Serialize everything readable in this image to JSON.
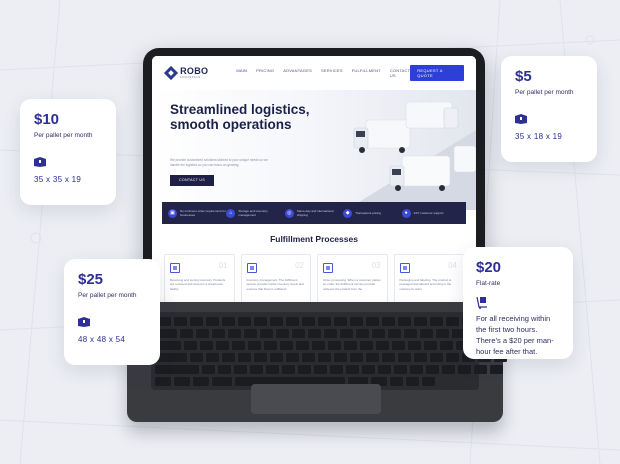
{
  "site": {
    "logo": "ROBO",
    "logo_sub": "LOGISTICS",
    "nav": [
      "MAIN",
      "PRICING",
      "ADVANTAGES",
      "SERVICES",
      "FULFILLMENT",
      "CONTACT US"
    ],
    "cta": "REQUEST A QUOTE",
    "hero_title": "Streamlined logistics, smooth operations",
    "hero_desc": "We provide customized solutions tailored to your unique needs so we handle the logistics so you can focus on growing.",
    "hero_button": "CONTACT US",
    "features": [
      "No minimum order requirement for businesses",
      "Storage and inventory management",
      "Same-day and international shipping",
      "Transparent pricing",
      "24/7 customer support"
    ],
    "process_title": "Fulfillment Processes",
    "process_steps": [
      {
        "num": "01",
        "text": "Receiving and storing inventory. Products are received and stored in a warehouse facility."
      },
      {
        "num": "02",
        "text": "Inventory management. The fulfillment service provider tracks inventory levels and ensures that there is sufficient"
      },
      {
        "num": "03",
        "text": "Order processing. When a customer places an order, the fulfillment service provider retrieves the product from the"
      },
      {
        "num": "04",
        "text": "Packaging and labeling. The product is packaged and labeled according to the customer's order."
      }
    ]
  },
  "cards": {
    "c10": {
      "price": "$10",
      "unit": "Per pallet per month",
      "dims": "35 x 35 x 19"
    },
    "c5": {
      "price": "$5",
      "unit": "Per pallet per month",
      "dims": "35 x 18 x 19"
    },
    "c25": {
      "price": "$25",
      "unit": "Per pallet per month",
      "dims": "48 x 48 x 54"
    },
    "c20": {
      "price": "$20",
      "unit": "Flat-rate",
      "note": "For all receiving within the first two hours. There's a $20 per man-hour fee after that."
    }
  },
  "colors": {
    "accent": "#2e2f95",
    "nav_dark": "#22244a",
    "cta_blue": "#2d3fd6"
  },
  "icons": {
    "box": "box-icon",
    "dolly": "dolly-icon"
  }
}
